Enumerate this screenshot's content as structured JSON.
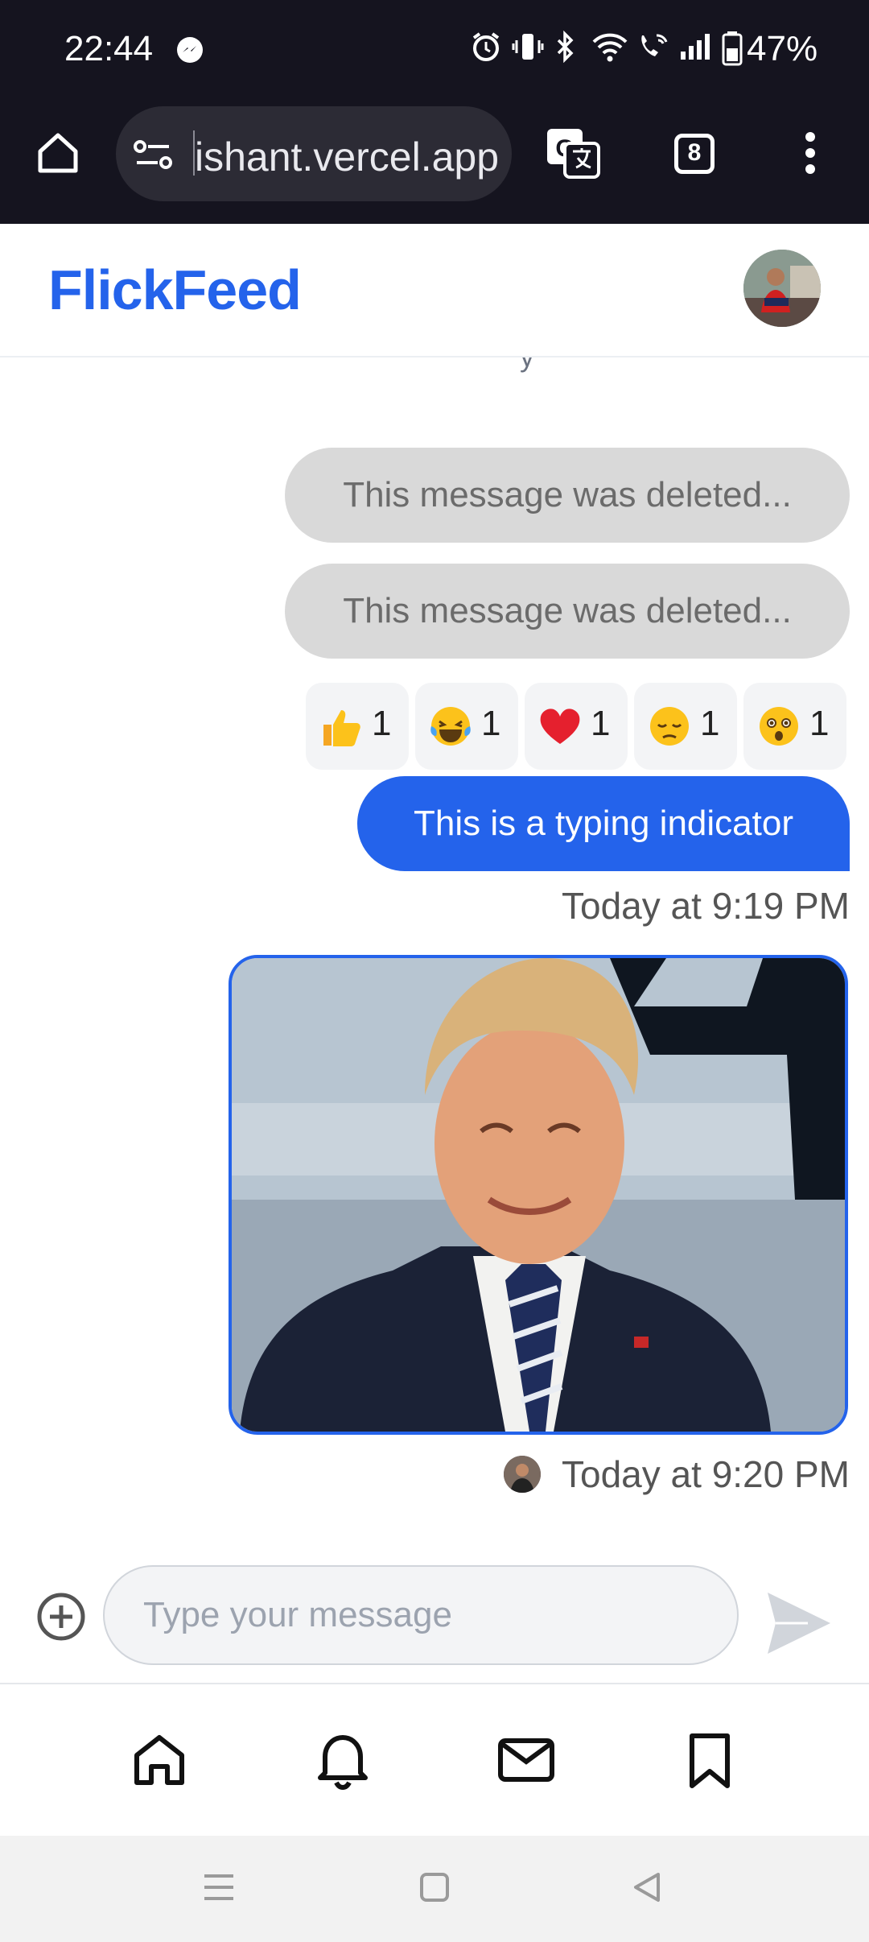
{
  "status_bar": {
    "time": "22:44",
    "battery": "47%",
    "icons": [
      "alarm-icon",
      "vibrate-icon",
      "bluetooth-icon",
      "wifi-icon",
      "wifi-call-icon",
      "signal-icon",
      "battery-icon"
    ]
  },
  "browser": {
    "url": "ishant.vercel.app",
    "tab_count": "8",
    "icons": [
      "home-icon",
      "site-settings-icon",
      "translate-icon",
      "tabs-icon",
      "more-menu-icon"
    ]
  },
  "app": {
    "logo": "FlickFeed",
    "brand_color": "#2463eb"
  },
  "chat": {
    "cut_off_text": "y",
    "messages": [
      {
        "type": "deleted",
        "text": "This message was deleted..."
      },
      {
        "type": "deleted",
        "text": "This message was deleted..."
      },
      {
        "type": "text",
        "text": "This is a typing indicator",
        "time": "Today at 9:19 PM"
      },
      {
        "type": "image",
        "time": "Today at 9:20 PM"
      }
    ],
    "reactions": [
      {
        "emoji": "thumbs-up-icon",
        "count": "1"
      },
      {
        "emoji": "laughing-tears-icon",
        "count": "1"
      },
      {
        "emoji": "red-heart-icon",
        "count": "1"
      },
      {
        "emoji": "pensive-face-icon",
        "count": "1"
      },
      {
        "emoji": "astonished-face-icon",
        "count": "1"
      }
    ]
  },
  "composer": {
    "placeholder": "Type your message",
    "value": ""
  },
  "bottom_nav": [
    "home-icon",
    "bell-icon",
    "mail-icon",
    "bookmark-icon"
  ]
}
